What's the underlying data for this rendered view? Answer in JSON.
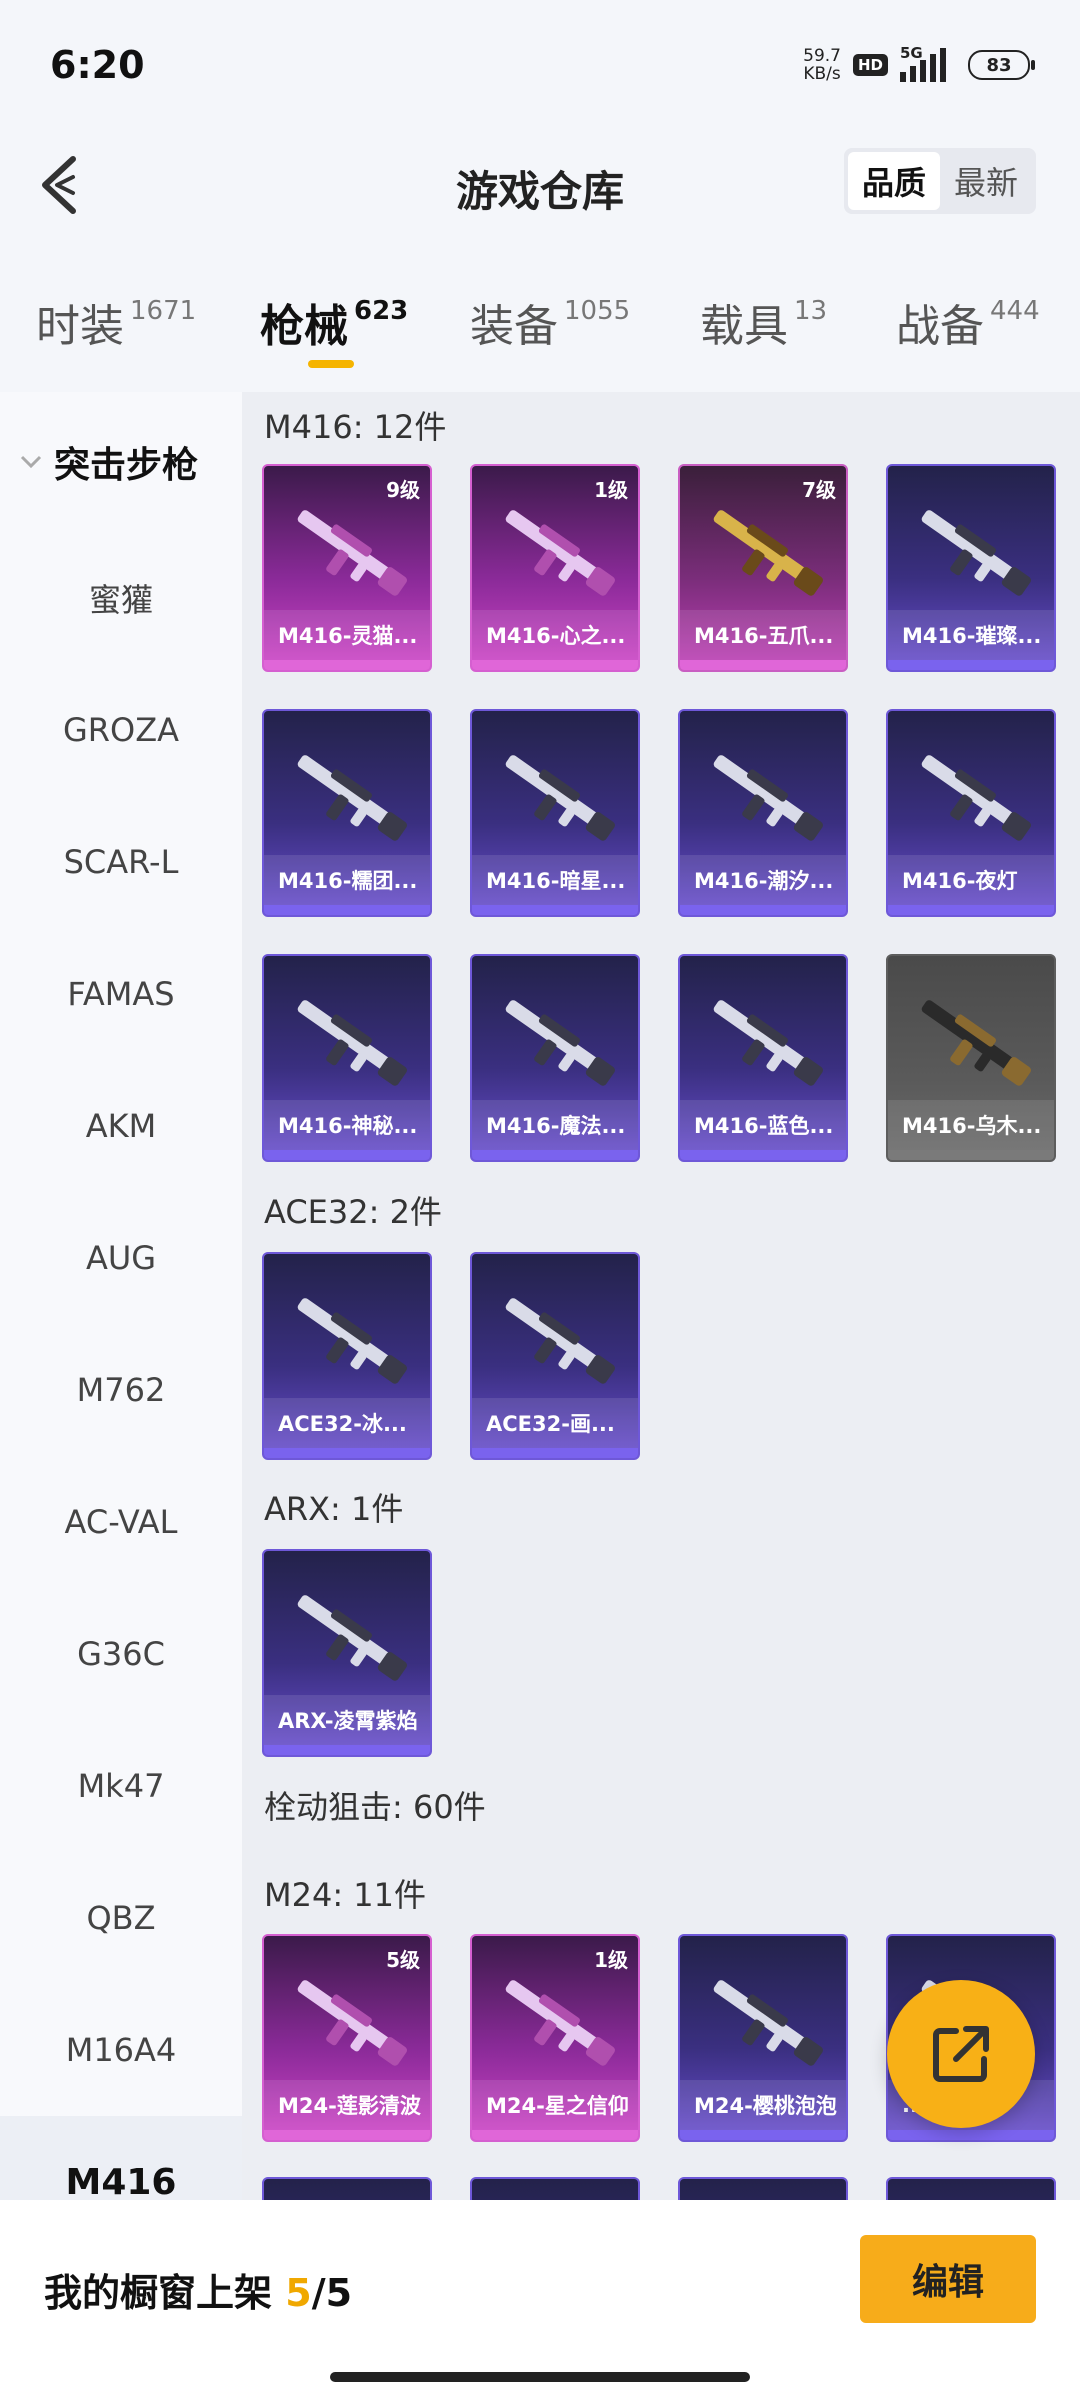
{
  "status_bar": {
    "time": "6:20",
    "net_speed_value": "59.7",
    "net_speed_unit": "KB/s",
    "hd": "HD",
    "network": "5G",
    "battery": "83"
  },
  "header": {
    "title": "游戏仓库",
    "sort_quality": "品质",
    "sort_newest": "最新"
  },
  "category_tabs": [
    {
      "label": "时装",
      "count": "1671"
    },
    {
      "label": "枪械",
      "count": "623",
      "active": true
    },
    {
      "label": "装备",
      "count": "1055"
    },
    {
      "label": "载具",
      "count": "13"
    },
    {
      "label": "战备",
      "count": "444"
    }
  ],
  "sidebar": {
    "group_label": "突击步枪",
    "items": [
      "蜜獾",
      "GROZA",
      "SCAR-L",
      "FAMAS",
      "AKM",
      "AUG",
      "M762",
      "AC-VAL",
      "G36C",
      "Mk47",
      "QBZ",
      "M16A4",
      "M416"
    ],
    "active": "M416"
  },
  "sections": {
    "m416_title": "M416: 12件",
    "ace32_title": "ACE32: 2件",
    "arx_title": "ARX: 1件",
    "sniper_title": "栓动狙击: 60件",
    "m24_title": "M24: 11件"
  },
  "m416_cards": [
    {
      "name": "M416-灵猫...",
      "level": "9级",
      "quality": "pink",
      "icon": "rifle-icon"
    },
    {
      "name": "M416-心之...",
      "level": "1级",
      "quality": "pink",
      "icon": "rifle-icon"
    },
    {
      "name": "M416-五爪...",
      "level": "7级",
      "quality": "gold",
      "icon": "rifle-icon"
    },
    {
      "name": "M416-璀璨...",
      "level": "",
      "quality": "purple",
      "icon": "rifle-icon"
    },
    {
      "name": "M416-糯团...",
      "level": "",
      "quality": "purple",
      "icon": "rifle-icon"
    },
    {
      "name": "M416-暗星...",
      "level": "",
      "quality": "purple",
      "icon": "rifle-icon"
    },
    {
      "name": "M416-潮汐...",
      "level": "",
      "quality": "purple",
      "icon": "rifle-icon"
    },
    {
      "name": "M416-夜灯",
      "level": "",
      "quality": "purple",
      "icon": "rifle-icon"
    },
    {
      "name": "M416-神秘...",
      "level": "",
      "quality": "purple",
      "icon": "rifle-icon"
    },
    {
      "name": "M416-魔法...",
      "level": "",
      "quality": "purple",
      "icon": "rifle-icon"
    },
    {
      "name": "M416-蓝色...",
      "level": "",
      "quality": "purple",
      "icon": "rifle-icon"
    },
    {
      "name": "M416-乌木...",
      "level": "",
      "quality": "gray",
      "icon": "rifle-icon"
    }
  ],
  "ace32_cards": [
    {
      "name": "ACE32-冰...",
      "quality": "purple"
    },
    {
      "name": "ACE32-画...",
      "quality": "purple"
    }
  ],
  "arx_cards": [
    {
      "name": "ARX-凌霄紫焰",
      "quality": "purple"
    }
  ],
  "m24_cards": [
    {
      "name": "M24-莲影清波",
      "level": "5级",
      "quality": "pink"
    },
    {
      "name": "M24-星之信仰",
      "level": "1级",
      "quality": "pink"
    },
    {
      "name": "M24-樱桃泡泡",
      "level": "",
      "quality": "purple"
    },
    {
      "name": "...",
      "level": "",
      "quality": "purple"
    }
  ],
  "bottom_bar": {
    "window_label": "我的橱窗上架",
    "window_used": "5",
    "window_total": "/5",
    "edit_label": "编辑"
  },
  "colors": {
    "accent": "#f7ac1a",
    "purple_card": "#6e58d8",
    "pink_card": "#d55fd0"
  }
}
